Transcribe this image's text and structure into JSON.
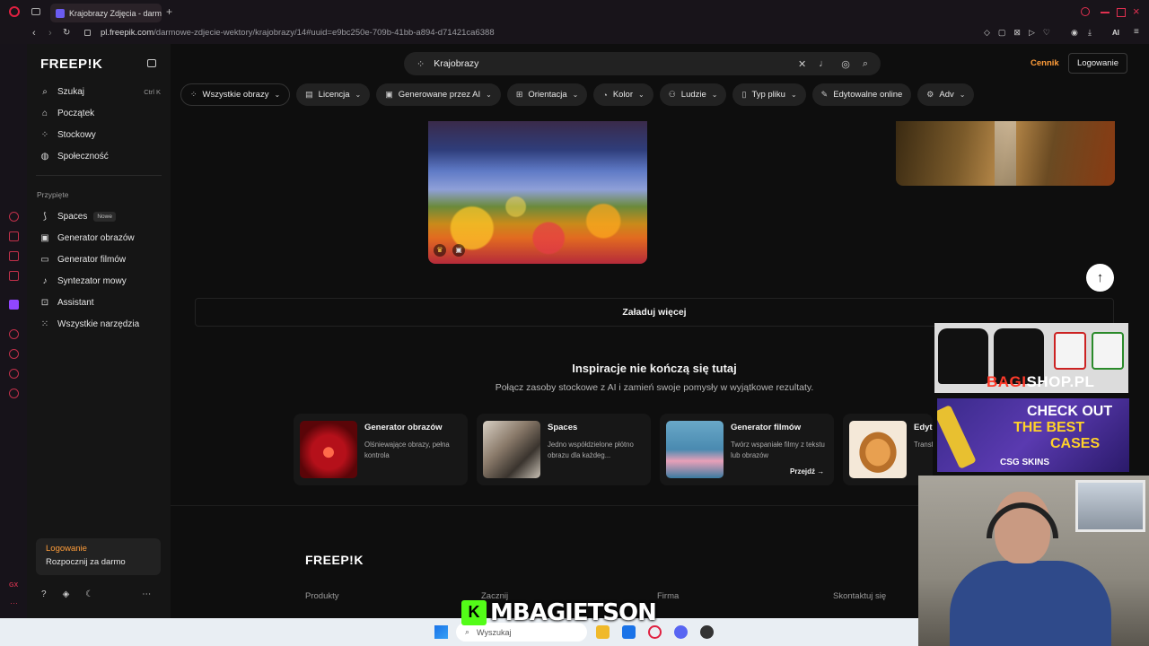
{
  "browser": {
    "tab_title": "Krajobrazy Zdjęcia - darmo",
    "url_host": "pl.freepik.com",
    "url_path": "/darmowe-zdjecie-wektory/krajobrazy/14#uuid=e9bc250e-709b-41bb-a894-d71421ca6388",
    "ai_label": "AI"
  },
  "sidebar": {
    "logo": "FREEP!K",
    "main_items": [
      {
        "label": "Szukaj",
        "shortcut": "Ctrl K"
      },
      {
        "label": "Początek"
      },
      {
        "label": "Stockowy"
      },
      {
        "label": "Społeczność"
      }
    ],
    "pinned_label": "Przypięte",
    "pinned_items": [
      {
        "label": "Spaces",
        "badge": "Nowe"
      },
      {
        "label": "Generator obrazów"
      },
      {
        "label": "Generator filmów"
      },
      {
        "label": "Syntezator mowy"
      },
      {
        "label": "Assistant"
      },
      {
        "label": "Wszystkie narzędzia"
      }
    ],
    "login_card": {
      "title": "Logowanie",
      "subtitle": "Rozpocznij za darmo"
    }
  },
  "header": {
    "search_value": "Krajobrazy",
    "pricing": "Cennik",
    "login": "Logowanie"
  },
  "filters": [
    {
      "label": "Wszystkie obrazy",
      "icon": "grid-icon"
    },
    {
      "label": "Licencja",
      "icon": "license-icon"
    },
    {
      "label": "Generowane przez AI",
      "icon": "image-ai-icon"
    },
    {
      "label": "Orientacja",
      "icon": "orientation-icon"
    },
    {
      "label": "Kolor",
      "icon": "palette-icon"
    },
    {
      "label": "Ludzie",
      "icon": "people-icon"
    },
    {
      "label": "Typ pliku",
      "icon": "file-icon"
    },
    {
      "label": "Edytowalne online",
      "icon": "pen-icon"
    },
    {
      "label": "Adv",
      "icon": "gear-icon"
    }
  ],
  "load_more": "Załaduj więcej",
  "inspiration": {
    "title": "Inspiracje nie kończą się tutaj",
    "subtitle": "Połącz zasoby stockowe z AI i zamień swoje pomysły w wyjątkowe rezultaty.",
    "cards": [
      {
        "title": "Generator obrazów",
        "desc": "Olśniewające obrazy, pełna kontrola"
      },
      {
        "title": "Spaces",
        "desc": "Jedno współdzielone płótno obrazu dla każdeg..."
      },
      {
        "title": "Generator filmów",
        "desc": "Twórz wspaniałe filmy z tekstu lub obrazów",
        "cta": "Przejdź"
      },
      {
        "title": "Edyto",
        "desc": "Transf obrazy"
      }
    ]
  },
  "footer": {
    "logo": "FREEP!K",
    "columns": [
      "Produkty",
      "Zacznij",
      "Firma",
      "Skontaktuj się"
    ]
  },
  "overlays": {
    "shop_brand_a": "BAGI",
    "shop_brand_b": "SHOP.PL",
    "ad_line1": "CHECK OUT",
    "ad_line2": "THE BEST",
    "ad_line3": "CASES",
    "ad_brand": "CSG SKINS",
    "streamer_name": "MBAGIETSON",
    "kick_letter": "K"
  },
  "taskbar": {
    "search_placeholder": "Wyszukaj"
  }
}
